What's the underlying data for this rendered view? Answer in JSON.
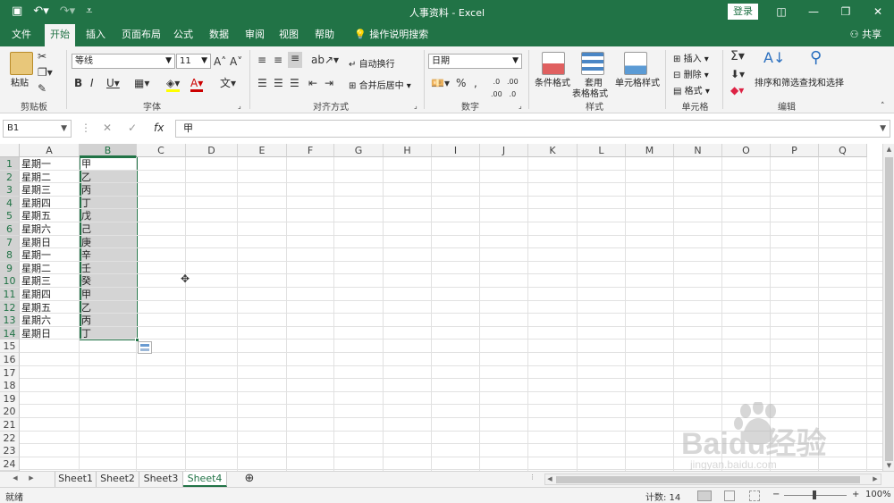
{
  "titlebar": {
    "title": "人事资料  -  Excel",
    "login": "登录",
    "save_icon": "save-icon",
    "undo_icon": "undo-icon",
    "redo_icon": "redo-icon"
  },
  "tabs": [
    {
      "label": "文件"
    },
    {
      "label": "开始"
    },
    {
      "label": "插入"
    },
    {
      "label": "页面布局"
    },
    {
      "label": "公式"
    },
    {
      "label": "数据"
    },
    {
      "label": "审阅"
    },
    {
      "label": "视图"
    },
    {
      "label": "帮助"
    }
  ],
  "tell_me": "操作说明搜索",
  "share": "共享",
  "ribbon": {
    "clipboard": {
      "paste": "粘贴",
      "label": "剪贴板"
    },
    "font": {
      "name": "等线",
      "size": "11",
      "label": "字体"
    },
    "alignment": {
      "wrap": "自动换行",
      "merge": "合并后居中",
      "label": "对齐方式"
    },
    "number": {
      "format": "日期",
      "label": "数字"
    },
    "styles": {
      "cond": "条件格式",
      "table": "套用\n表格格式",
      "table_1": "套用",
      "table_2": "表格格式",
      "cell": "单元格样式",
      "label": "样式"
    },
    "cells": {
      "insert": "插入",
      "delete": "删除",
      "format": "格式",
      "label": "单元格"
    },
    "editing": {
      "sort": "排序和筛选",
      "find": "查找和选择",
      "label": "编辑"
    }
  },
  "formula_bar": {
    "name_box": "B1",
    "value": "甲"
  },
  "columns": [
    "A",
    "B",
    "C",
    "D",
    "E",
    "F",
    "G",
    "H",
    "I",
    "J",
    "K",
    "L",
    "M",
    "N",
    "O",
    "P",
    "Q"
  ],
  "rows": [
    "1",
    "2",
    "3",
    "4",
    "5",
    "6",
    "7",
    "8",
    "9",
    "10",
    "11",
    "12",
    "13",
    "14",
    "15",
    "16",
    "17",
    "18",
    "19",
    "20",
    "21",
    "22",
    "23",
    "24"
  ],
  "cells": {
    "A": [
      "星期一",
      "星期二",
      "星期三",
      "星期四",
      "星期五",
      "星期六",
      "星期日",
      "星期一",
      "星期二",
      "星期三",
      "星期四",
      "星期五",
      "星期六",
      "星期日"
    ],
    "B": [
      "甲",
      "乙",
      "丙",
      "丁",
      "戊",
      "己",
      "庚",
      "辛",
      "壬",
      "癸",
      "甲",
      "乙",
      "丙",
      "丁"
    ]
  },
  "sheets": [
    "Sheet1",
    "Sheet2",
    "Sheet3",
    "Sheet4"
  ],
  "active_sheet": "Sheet4",
  "status": {
    "ready": "就绪",
    "count": "计数: 14",
    "zoom": "100%"
  },
  "watermark": {
    "text": "Baidu经验",
    "sub": "jingyan.baidu.com"
  },
  "colors": {
    "accent": "#217346"
  }
}
